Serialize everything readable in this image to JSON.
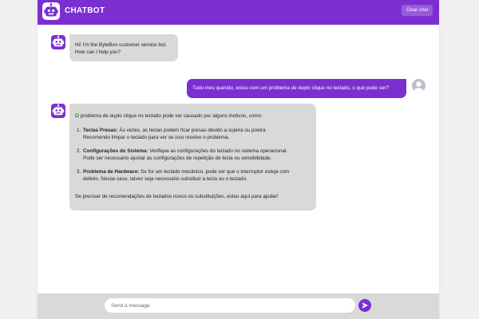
{
  "theme": {
    "accent": "#7b2fd1",
    "bot_bubble": "#d9d9d9",
    "background": "#f0f0f0"
  },
  "header": {
    "logo_icon": "robot-icon",
    "title": "CHATBOT",
    "clear_label": "Clear chat"
  },
  "messages": [
    {
      "sender": "bot",
      "avatar_icon": "robot-icon",
      "lines": [
        "Hi! I'm the ByteBox customer service bot.",
        "How can I help you?"
      ]
    },
    {
      "sender": "user",
      "avatar_icon": "user-avatar-icon",
      "text": "Tudo meu querido, estou com um problema de duplo clique no teclado, o que pode ser?"
    },
    {
      "sender": "bot",
      "avatar_icon": "robot-icon",
      "intro": "O problema de duplo clique no teclado pode ser causado por alguns motivos, como:",
      "items": [
        {
          "num": "1.",
          "title": "Teclas Presas:",
          "line1": " Às vezes, as teclas podem ficar presas devido a sujeira ou poeira.",
          "line2": "Recomendo limpar o teclado para ver se isso resolve o problema."
        },
        {
          "num": "2.",
          "title": "Configurações do Sistema:",
          "line1": " Verifique as configurações do teclado no sistema operacional.",
          "line2": "Pode ser necessário ajustar as configurações de repetição de tecla ou sensibilidade."
        },
        {
          "num": "3.",
          "title": "Problema de Hardware:",
          "line1": " Se for um teclado mecânico, pode ser que o interruptor esteja com",
          "line2": "defeito. Nesse caso, talvez seja necessário substituir a tecla ou o teclado."
        }
      ],
      "outro": "Se precisar de recomendações de teclados novos ou substituições, estou aqui para ajudar!"
    }
  ],
  "composer": {
    "placeholder": "Send a message",
    "value": "",
    "send_icon": "send-icon"
  }
}
